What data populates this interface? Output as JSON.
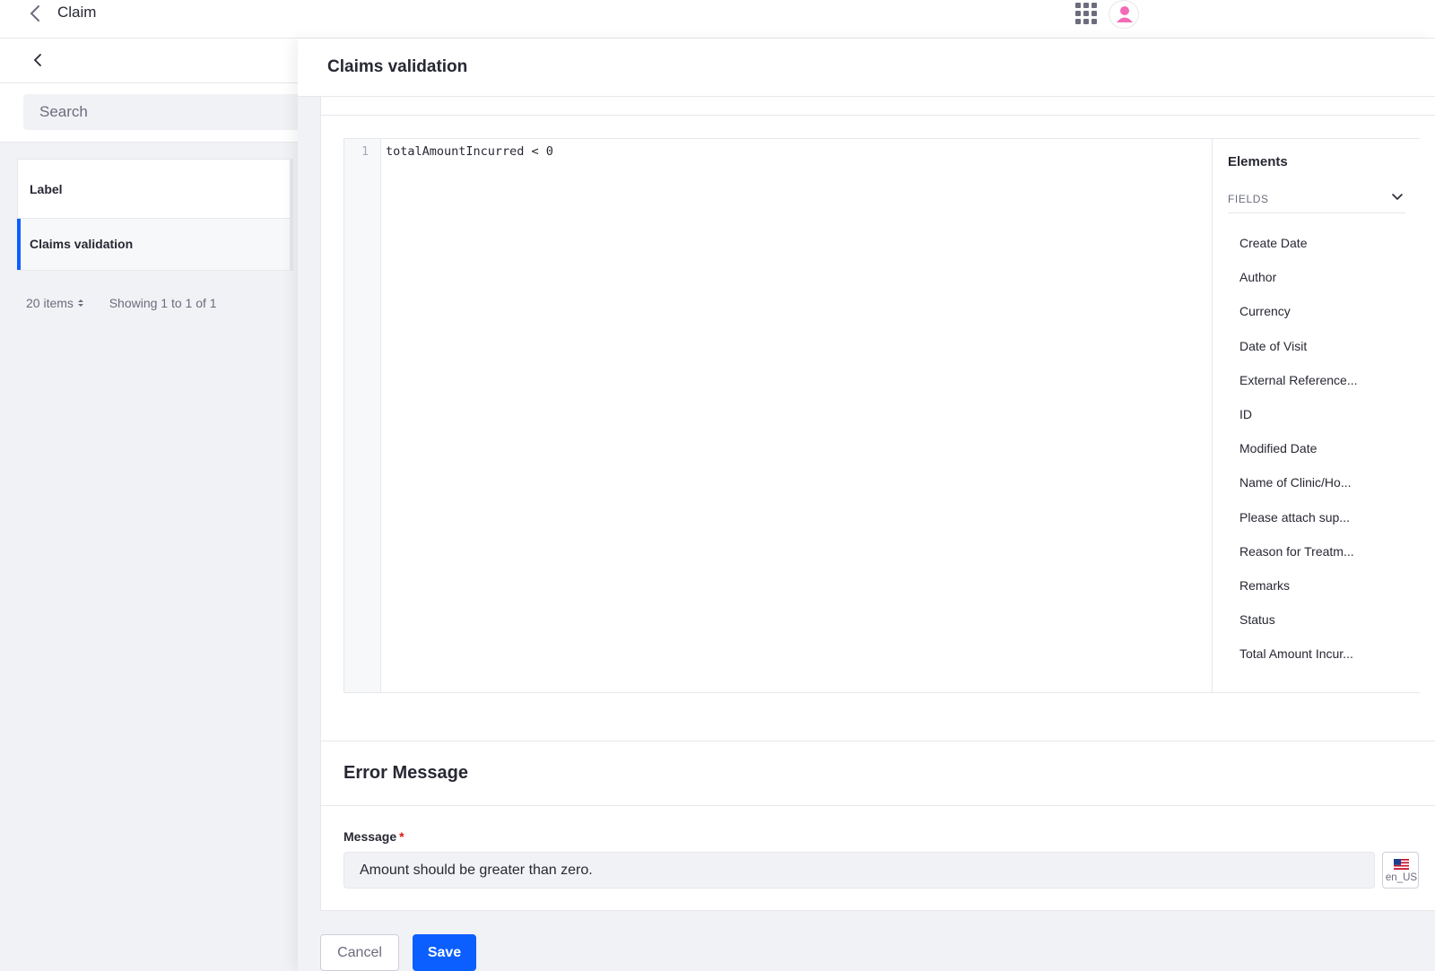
{
  "header": {
    "title": "Claim",
    "back_icon": "chevron-left-icon",
    "apps_icon": "apps-grid-icon",
    "avatar_icon": "user-avatar-icon",
    "avatar_color": "#f36ab7"
  },
  "left_pane": {
    "search_placeholder": "Search",
    "list_header": "Label",
    "rows": [
      "Claims validation"
    ],
    "items_per_page": "20 items",
    "showing": "Showing 1 to 1 of 1"
  },
  "panel": {
    "title": "Claims validation",
    "editor": {
      "line_numbers": [
        "1"
      ],
      "code": "totalAmountIncurred < 0"
    },
    "elements": {
      "title": "Elements",
      "section": "FIELDS",
      "fields": [
        "Create Date",
        "Author",
        "Currency",
        "Date of Visit",
        "External Reference...",
        "ID",
        "Modified Date",
        "Name of Clinic/Ho...",
        "Please attach sup...",
        "Reason for Treatm...",
        "Remarks",
        "Status",
        "Total Amount Incur..."
      ]
    },
    "error_message": {
      "title": "Error Message",
      "label": "Message",
      "required_mark": "*",
      "value": "Amount should be greater than zero.",
      "locale": "en_US"
    },
    "buttons": {
      "cancel": "Cancel",
      "save": "Save"
    }
  },
  "colors": {
    "primary": "#0b5fff",
    "required": "#da1414",
    "border": "#e7e7ed"
  }
}
